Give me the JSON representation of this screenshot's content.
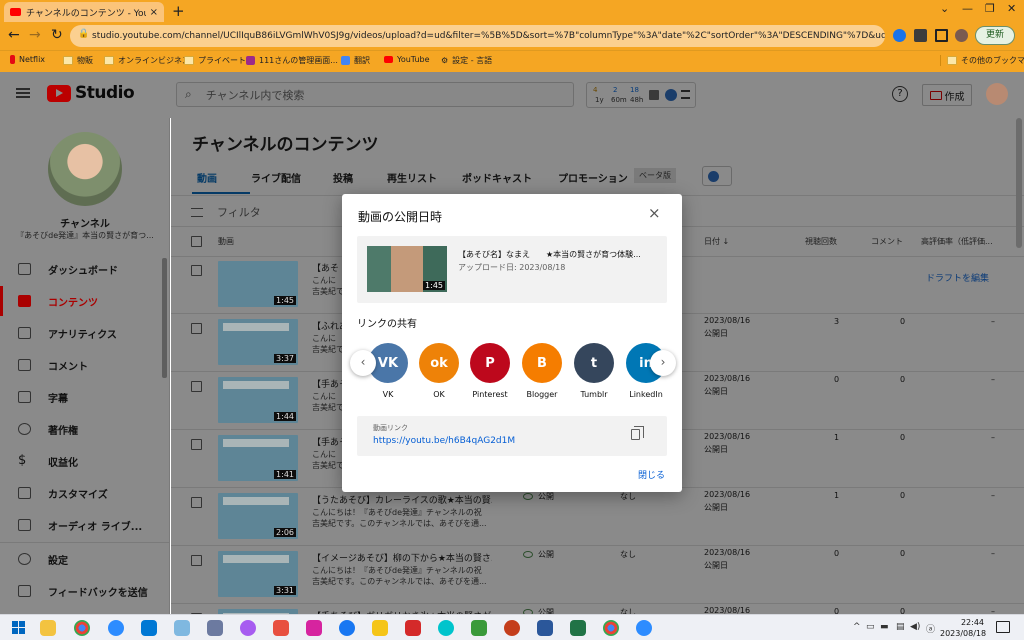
{
  "browser": {
    "tab_title": "チャンネルのコンテンツ - YouTube Stu",
    "tab_close": "×",
    "new_tab": "+",
    "url": "studio.youtube.com/channel/UCIlIquB86iLVGmlWhV0SJ9g/videos/upload?d=ud&filter=%5B%5D&sort=%7B\"columnType\"%3A\"date\"%2C\"sortOrder\"%3A\"DESCENDING\"%7D&ud...",
    "update_label": "更新",
    "bookmarks": [
      "Netflix",
      "物販",
      "オンラインビジネス",
      "プライベート",
      "111さんの管理画面...",
      "翻訳",
      "YouTube",
      "設定 - 言語"
    ],
    "other_bookmarks": "その他のブックマーク"
  },
  "studio": {
    "logo": "Studio",
    "search_placeholder": "チャンネル内で検索",
    "stats": {
      "a": "4",
      "a_sub": "1y",
      "b": "2",
      "b_sub": "60m",
      "c": "18",
      "c_sub": "48h"
    },
    "create_label": "作成",
    "help": "?"
  },
  "sidebar": {
    "channel_name": "チャンネル",
    "channel_sub": "『あそびde発達』本当の賢さが育つ...",
    "items": [
      {
        "label": "ダッシュボード"
      },
      {
        "label": "コンテンツ"
      },
      {
        "label": "アナリティクス"
      },
      {
        "label": "コメント"
      },
      {
        "label": "字幕"
      },
      {
        "label": "著作権"
      },
      {
        "label": "収益化"
      },
      {
        "label": "カスタマイズ"
      },
      {
        "label": "オーディオ ライブ..."
      },
      {
        "label": "設定"
      },
      {
        "label": "フィードバックを送信"
      }
    ]
  },
  "main": {
    "title": "チャンネルのコンテンツ",
    "tabs": [
      "動画",
      "ライブ配信",
      "投稿",
      "再生リスト",
      "ポッドキャスト",
      "プロモーション"
    ],
    "beta": "ベータ版",
    "filter": "フィルタ",
    "columns": {
      "video": "動画",
      "date": "日付 ↓",
      "views": "視聴回数",
      "comments": "コメント",
      "rating": "高評価率（低評価..."
    },
    "rows": [
      {
        "title": "【あそ",
        "desc": "こんに\n吉美紀で",
        "duration": "1:45",
        "visibility": "",
        "restriction": "",
        "date": "",
        "date_sub": "",
        "views": "",
        "comments": "",
        "rating": "",
        "draft_link": "ドラフトを編集"
      },
      {
        "title": "【ふれあ",
        "desc": "こんに\n吉美紀で",
        "duration": "3:37",
        "visibility": "",
        "restriction": "",
        "date": "2023/08/16",
        "date_sub": "公開日",
        "views": "3",
        "comments": "0",
        "rating": "–",
        "draft_link": ""
      },
      {
        "title": "【手あそ",
        "desc": "こんに\n吉美紀で",
        "duration": "1:44",
        "visibility": "",
        "restriction": "",
        "date": "2023/08/16",
        "date_sub": "公開日",
        "views": "0",
        "comments": "0",
        "rating": "–",
        "draft_link": ""
      },
      {
        "title": "【手あそ",
        "desc": "こんに\n吉美紀で",
        "duration": "1:41",
        "visibility": "",
        "restriction": "",
        "date": "2023/08/16",
        "date_sub": "公開日",
        "views": "1",
        "comments": "0",
        "rating": "–",
        "draft_link": ""
      },
      {
        "title": "【うたあそび】カレーライスの歌★本当の賢...",
        "desc": "こんにちは！『あそびde発達』チャンネルの祝\n吉美紀です。このチャンネルでは、あそびを通...",
        "duration": "2:06",
        "visibility": "公開",
        "restriction": "なし",
        "date": "2023/08/16",
        "date_sub": "公開日",
        "views": "1",
        "comments": "0",
        "rating": "–",
        "draft_link": ""
      },
      {
        "title": "【イメージあそび】柳の下から★本当の賢さ...",
        "desc": "こんにちは！『あそびde発達』チャンネルの祝\n吉美紀です。このチャンネルでは、あそびを通...",
        "duration": "3:31",
        "visibility": "公開",
        "restriction": "なし",
        "date": "2023/08/16",
        "date_sub": "公開日",
        "views": "0",
        "comments": "0",
        "rating": "–",
        "draft_link": ""
      },
      {
        "title": "【手あそび】ガリガリかき氷★本当の賢さが...",
        "desc": "",
        "duration": "",
        "visibility": "公開",
        "restriction": "なし",
        "date": "2023/08/16",
        "date_sub": "",
        "views": "0",
        "comments": "0",
        "rating": "–",
        "draft_link": ""
      }
    ]
  },
  "modal": {
    "title": "動画の公開日時",
    "close": "×",
    "video_title": "【あそび名】なまえ　　★本当の賢さが育つ体験...",
    "video_sub": "アップロード日: 2023/08/18",
    "video_duration": "1:45",
    "share_title": "リンクの共有",
    "share": [
      {
        "label": "VK",
        "glyph": "VK",
        "color": "#4a76a8"
      },
      {
        "label": "OK",
        "glyph": "ok",
        "color": "#ee8208"
      },
      {
        "label": "Pinterest",
        "glyph": "P",
        "color": "#bd081c"
      },
      {
        "label": "Blogger",
        "glyph": "B",
        "color": "#f57d00"
      },
      {
        "label": "Tumblr",
        "glyph": "t",
        "color": "#35465c"
      },
      {
        "label": "LinkedIn",
        "glyph": "in",
        "color": "#0077b5"
      }
    ],
    "prev": "‹",
    "next": "›",
    "link_label": "動画リンク",
    "link_url": "https://youtu.be/h6B4qAG2d1M",
    "close_button": "閉じる"
  },
  "taskbar": {
    "time": "22:44",
    "date": "2023/08/18"
  }
}
